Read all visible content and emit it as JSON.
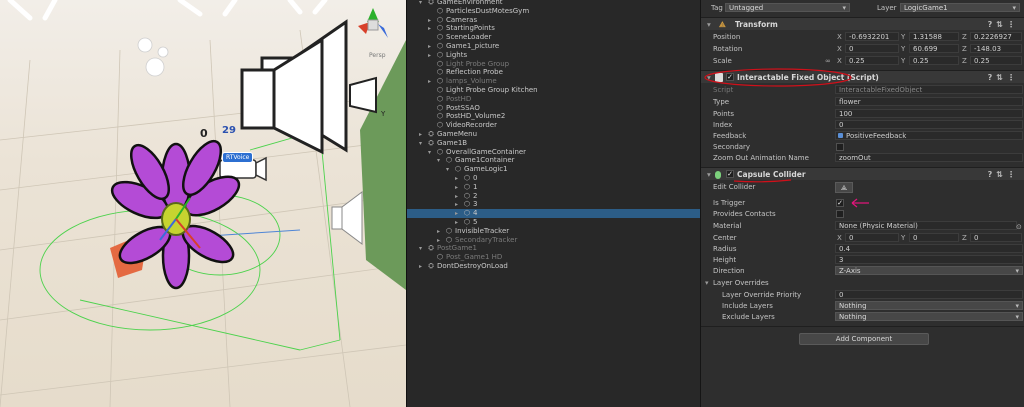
{
  "scene": {
    "score_left": "0",
    "score_right": "29",
    "rtvoice_label": "RTVoice",
    "perspective_label": "Persp",
    "axis_label": "Y"
  },
  "hierarchy": {
    "items": [
      {
        "label": "GameEnvironment",
        "indent": 0,
        "arrow": "▾",
        "icon": "gameobject",
        "dim": false
      },
      {
        "label": "ParticlesDustMotesGym",
        "indent": 1,
        "arrow": "",
        "icon": "cube",
        "dim": false
      },
      {
        "label": "Cameras",
        "indent": 1,
        "arrow": "▸",
        "icon": "cube",
        "dim": false
      },
      {
        "label": "StartingPoints",
        "indent": 1,
        "arrow": "▸",
        "icon": "cube",
        "dim": false
      },
      {
        "label": "SceneLoader",
        "indent": 1,
        "arrow": "",
        "icon": "cube",
        "dim": false
      },
      {
        "label": "Game1_picture",
        "indent": 1,
        "arrow": "▸",
        "icon": "cube",
        "dim": false
      },
      {
        "label": "Lights",
        "indent": 1,
        "arrow": "▸",
        "icon": "cube",
        "dim": false
      },
      {
        "label": "Light Probe Group",
        "indent": 1,
        "arrow": "",
        "icon": "cube",
        "dim": true
      },
      {
        "label": "Reflection Probe",
        "indent": 1,
        "arrow": "",
        "icon": "cube",
        "dim": false
      },
      {
        "label": "lamps_Volume",
        "indent": 1,
        "arrow": "▸",
        "icon": "cube",
        "dim": true
      },
      {
        "label": "Light Probe Group Kitchen",
        "indent": 1,
        "arrow": "",
        "icon": "cube",
        "dim": false
      },
      {
        "label": "PostHD",
        "indent": 1,
        "arrow": "",
        "icon": "cube",
        "dim": true
      },
      {
        "label": "PostSSAO",
        "indent": 1,
        "arrow": "",
        "icon": "cube",
        "dim": false
      },
      {
        "label": "PostHD_Volume2",
        "indent": 1,
        "arrow": "",
        "icon": "cube",
        "dim": false
      },
      {
        "label": "VideoRecorder",
        "indent": 1,
        "arrow": "",
        "icon": "cube",
        "dim": false
      },
      {
        "label": "GameMenu",
        "indent": 0,
        "arrow": "▸",
        "icon": "gameobject",
        "dim": false
      },
      {
        "label": "Game1B",
        "indent": 0,
        "arrow": "▾",
        "icon": "gameobject",
        "dim": false
      },
      {
        "label": "OverallGameContainer",
        "indent": 1,
        "arrow": "▾",
        "icon": "cube",
        "dim": false
      },
      {
        "label": "Game1Container",
        "indent": 2,
        "arrow": "▾",
        "icon": "cube",
        "dim": false
      },
      {
        "label": "GameLogic1",
        "indent": 3,
        "arrow": "▾",
        "icon": "cube",
        "dim": false
      },
      {
        "label": "0",
        "indent": 4,
        "arrow": "▸",
        "icon": "cube",
        "dim": false
      },
      {
        "label": "1",
        "indent": 4,
        "arrow": "▸",
        "icon": "cube",
        "dim": false
      },
      {
        "label": "2",
        "indent": 4,
        "arrow": "▸",
        "icon": "cube",
        "dim": false
      },
      {
        "label": "3",
        "indent": 4,
        "arrow": "▸",
        "icon": "cube",
        "dim": false
      },
      {
        "label": "4",
        "indent": 4,
        "arrow": "▸",
        "icon": "cube",
        "dim": false,
        "selected": true
      },
      {
        "label": "5",
        "indent": 4,
        "arrow": "▸",
        "icon": "cube",
        "dim": false
      },
      {
        "label": "InvisibleTracker",
        "indent": 2,
        "arrow": "▸",
        "icon": "cube",
        "dim": false
      },
      {
        "label": "SecondaryTracker",
        "indent": 2,
        "arrow": "▸",
        "icon": "cube",
        "dim": true
      },
      {
        "label": "PostGame1",
        "indent": 0,
        "arrow": "▾",
        "icon": "gameobject",
        "dim": true
      },
      {
        "label": "Post_Game1 HD",
        "indent": 1,
        "arrow": "",
        "icon": "cube",
        "dim": true
      },
      {
        "label": "DontDestroyOnLoad",
        "indent": 0,
        "arrow": "▸",
        "icon": "gameobject",
        "dim": false
      }
    ]
  },
  "inspector": {
    "tag_label": "Tag",
    "tag_value": "Untagged",
    "layer_label": "Layer",
    "layer_value": "LogicGame1",
    "transform": {
      "title": "Transform",
      "position_label": "Position",
      "position": [
        "-0.6932201",
        "1.31588",
        "0.2226927"
      ],
      "rotation_label": "Rotation",
      "rotation": [
        "0",
        "60.699",
        "-148.03"
      ],
      "scale_label": "Scale",
      "scale": [
        "0.25",
        "0.25",
        "0.25"
      ]
    },
    "script_comp": {
      "title": "Interactable Fixed Object (Script)",
      "script_label": "Script",
      "script_value": "InteractableFixedObject",
      "type_label": "Type",
      "type_value": "flower",
      "points_label": "Points",
      "points_value": "100",
      "index_label": "Index",
      "index_value": "0",
      "feedback_label": "Feedback",
      "feedback_value": "PositiveFeedback",
      "secondary_label": "Secondary",
      "zoom_label": "Zoom Out Animation Name",
      "zoom_value": "zoomOut"
    },
    "collider": {
      "title": "Capsule Collider",
      "edit_label": "Edit Collider",
      "trigger_label": "Is Trigger",
      "contacts_label": "Provides Contacts",
      "material_label": "Material",
      "material_value": "None (Physic Material)",
      "center_label": "Center",
      "center": [
        "0",
        "0",
        "0"
      ],
      "radius_label": "Radius",
      "radius_value": "0.4",
      "height_label": "Height",
      "height_value": "3",
      "direction_label": "Direction",
      "direction_value": "Z-Axis",
      "overrides_label": "Layer Overrides",
      "priority_label": "Layer Override Priority",
      "priority_value": "0",
      "include_label": "Include Layers",
      "include_value": "Nothing",
      "exclude_label": "Exclude Layers",
      "exclude_value": "Nothing"
    },
    "axis_x": "X",
    "axis_y": "Y",
    "axis_z": "Z",
    "add_component_label": "Add Component"
  },
  "colors": {
    "selection": "#2c5d87",
    "annotation_red": "#d0101a",
    "annotation_pink": "#e0147a",
    "flower": "#b44bd6"
  }
}
